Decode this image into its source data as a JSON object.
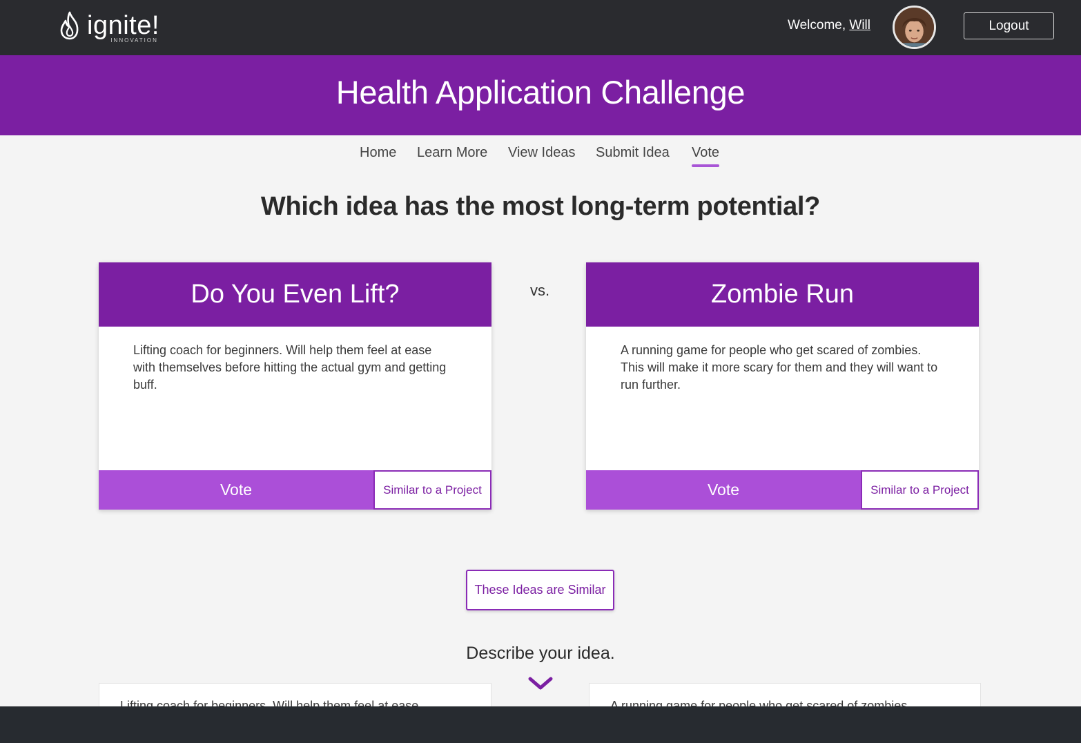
{
  "brand": {
    "name": "ignite!",
    "tagline": "INNOVATION"
  },
  "header": {
    "welcome_prefix": "Welcome, ",
    "user_name": "Will",
    "logout_label": "Logout"
  },
  "banner": {
    "title": "Health Application Challenge"
  },
  "nav": {
    "items": [
      "Home",
      "Learn More",
      "View Ideas",
      "Submit Idea",
      "Vote"
    ],
    "active": "Vote"
  },
  "question": "Which idea has the most long-term potential?",
  "vs_label": "vs.",
  "ideas": [
    {
      "title": "Do You Even Lift?",
      "description": "Lifting coach for beginners. Will help them feel at ease with themselves before hitting the actual gym and getting buff.",
      "vote_label": "Vote",
      "similar_label": "Similar to a Project"
    },
    {
      "title": "Zombie Run",
      "description": "A running game for people who get scared of zombies. This will make it more scary for them and they will want to run further.",
      "vote_label": "Vote",
      "similar_label": "Similar to a Project"
    }
  ],
  "similar_ideas_label": "These Ideas are Similar",
  "describe_heading": "Describe your idea.",
  "previews": [
    "Lifting coach for beginners. Will help them feel at ease",
    "A running game for people who get scared of zombies"
  ],
  "colors": {
    "topbar": "#2a2b2f",
    "brand_purple": "#7b1fa2",
    "vote_purple": "#ab4fd8",
    "background": "#f4f4f4"
  },
  "icons": [
    "flame-icon",
    "chevron-down-icon"
  ]
}
